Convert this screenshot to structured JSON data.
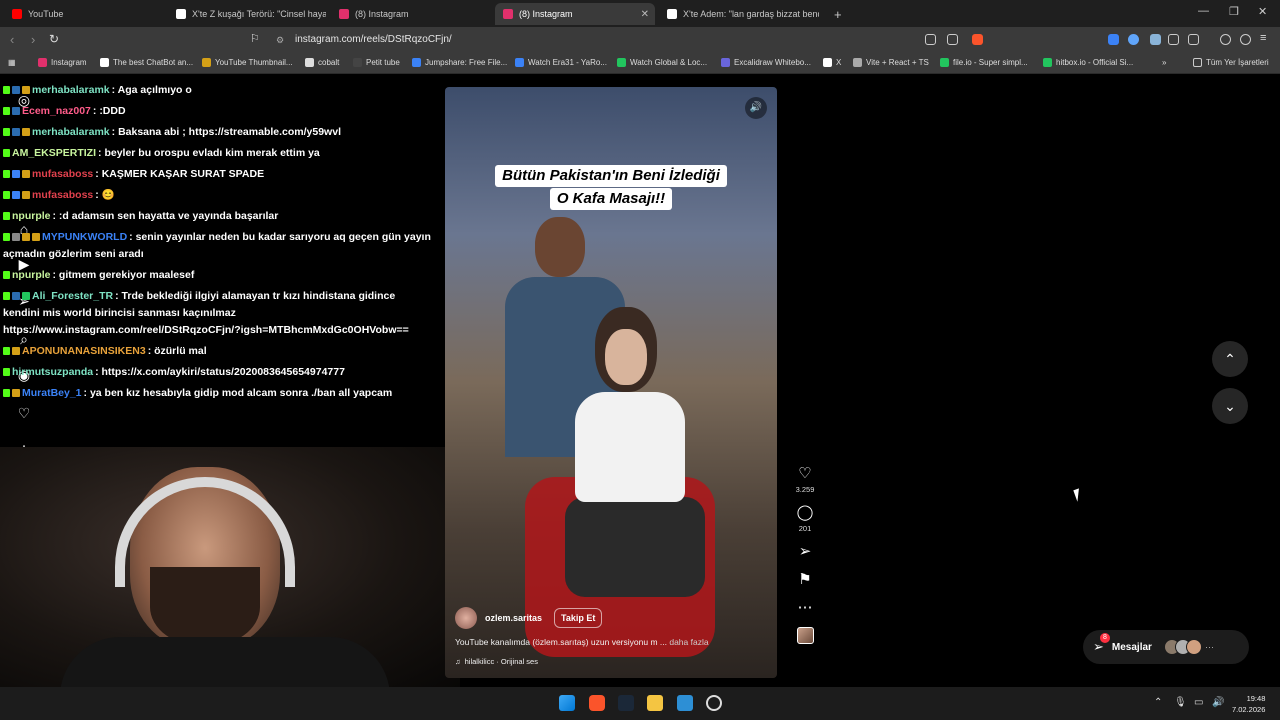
{
  "browser": {
    "tabs": [
      {
        "title": "YouTube",
        "color": "#ff0000"
      },
      {
        "title": "X'te Z kuşağı Terörü: \"Cinsel hayatı ca",
        "color": "#ffffff"
      },
      {
        "title": "(8) Instagram",
        "color": "#e1306c"
      },
      {
        "title": "(8) Instagram",
        "color": "#e1306c",
        "active": true
      },
      {
        "title": "X'te Adem: \"lan gardaş bizzat bende",
        "color": "#ffffff"
      }
    ],
    "new_tab": "+",
    "url": "instagram.com/reels/DStRqzoCFjn/",
    "bookmarks": [
      {
        "label": "Instagram",
        "color": "#e1306c"
      },
      {
        "label": "The best ChatBot an...",
        "color": "#ffffff"
      },
      {
        "label": "YouTube Thumbnail...",
        "color": "#d4a017"
      },
      {
        "label": "cobalt",
        "color": "#dddddd"
      },
      {
        "label": "Petit tube",
        "color": "#444444"
      },
      {
        "label": "Jumpshare: Free File...",
        "color": "#3b82f6"
      },
      {
        "label": "Watch Era31 - YaRo...",
        "color": "#3b82f6"
      },
      {
        "label": "Watch Global & Loc...",
        "color": "#22c55e"
      },
      {
        "label": "Excalidraw Whitebo...",
        "color": "#6965db"
      },
      {
        "label": "X",
        "color": "#ffffff"
      },
      {
        "label": "Vite + React + TS",
        "color": "#aaaaaa"
      },
      {
        "label": "file.io - Super simpl...",
        "color": "#22c55e"
      },
      {
        "label": "hitbox.io - Official Si...",
        "color": "#22c55e"
      }
    ],
    "bookmarks_more": "»",
    "all_bookmarks": "Tüm Yer İşaretleri"
  },
  "chat": [
    {
      "user": "merhabalaramk",
      "color": "#7ee3c4",
      "badges": [
        "#2b6cb0",
        "#d4a017"
      ],
      "text": "Aga açılmıyo o"
    },
    {
      "user": "Ecem_naz007",
      "color": "#ff5c8a",
      "badges": [
        "#2b6cb0"
      ],
      "text": ":DDD"
    },
    {
      "user": "merhabalaramk",
      "color": "#7ee3c4",
      "badges": [
        "#2b6cb0",
        "#d4a017"
      ],
      "text": "Baksana abi ; https://streamable.com/y59wvl"
    },
    {
      "user": "AM_EKSPERTIZI",
      "color": "#c8f59e",
      "badges": [],
      "text": "beyler bu orospu evladı kim merak ettim ya"
    },
    {
      "user": "mufasaboss",
      "color": "#e0414d",
      "badges": [
        "#3b82f6",
        "#d4a017"
      ],
      "text": "KAŞMER KAŞAR SURAT SPADE"
    },
    {
      "user": "mufasaboss",
      "color": "#e0414d",
      "badges": [
        "#3b82f6",
        "#d4a017"
      ],
      "text": "😊"
    },
    {
      "user": "npurple",
      "color": "#c8f59e",
      "badges": [],
      "text": ":d adamsın sen hayatta ve yayında başarılar"
    },
    {
      "user": "MYPUNKWORLD",
      "color": "#3b82f6",
      "badges": [
        "#888888",
        "#d4a017",
        "#d4a017"
      ],
      "text": "senin yayınlar neden bu kadar sarıyoru aq geçen gün yayın açmadın gözlerim seni aradı"
    },
    {
      "user": "npurple",
      "color": "#c8f59e",
      "badges": [],
      "text": "gitmem gerekiyor maalesef"
    },
    {
      "user": "Ali_Forester_TR",
      "color": "#7ee3c4",
      "badges": [
        "#2b6cb0",
        "#22c55e"
      ],
      "text": "Trde beklediği ilgiyi alamayan tr kızı hindistana gidince kendini mis world birincisi sanması kaçınılmaz https://www.instagram.com/reel/DStRqzoCFjn/?igsh=MTBhcmMxdGc0OHVobw=="
    },
    {
      "user": "APONUNANASINSIKEN3",
      "color": "#e8a23a",
      "badges": [
        "#d4a017"
      ],
      "text": "özürlü mal"
    },
    {
      "user": "hirmutsuzpanda",
      "color": "#7ee3c4",
      "badges": [],
      "text": "https://x.com/aykiri/status/2020083645654974777"
    },
    {
      "user": "MuratBey_1",
      "color": "#3b82f6",
      "badges": [
        "#d4a017"
      ],
      "text": "ya ben kız hesabıyla gidip mod alcam sonra ./ban all yapcam"
    }
  ],
  "reel": {
    "caption_line1": "Bütün Pakistan'ın Beni İzlediği",
    "caption_line2": "O Kafa Masajı!!",
    "author": "ozlem.saritas",
    "follow_label": "Takip Et",
    "description": "YouTube kanalımda (özlem.sarıtaş) uzun versiyonu m ...",
    "more_label": "daha fazla",
    "audio": "hilalkilicc · Orijinal ses",
    "likes": "3.259",
    "comments": "201"
  },
  "messages": {
    "label": "Mesajlar",
    "badge": "8"
  },
  "taskbar": {
    "time": "19:48",
    "date": "7.02.2026"
  }
}
